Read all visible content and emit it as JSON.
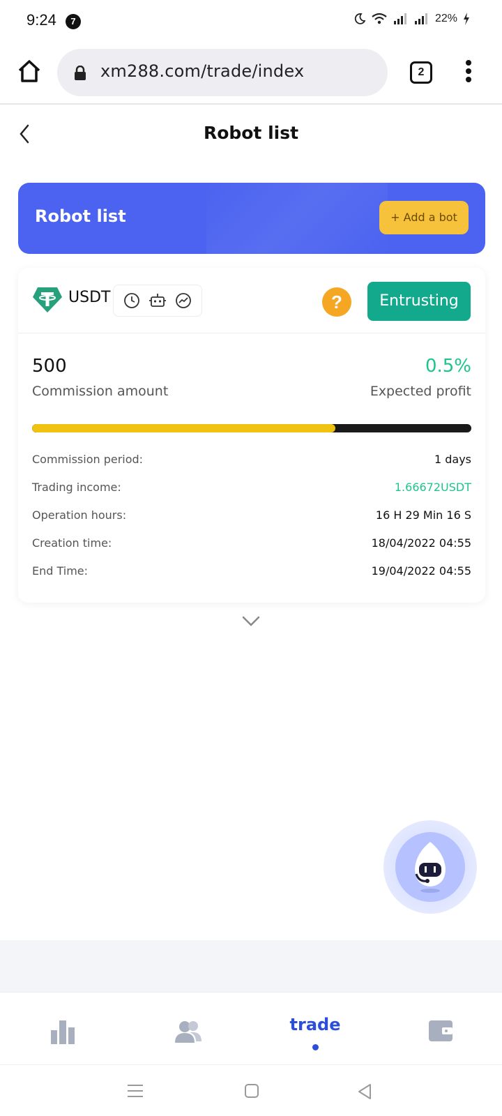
{
  "status_bar": {
    "time": "9:24",
    "notification_count": "7",
    "battery": "22%"
  },
  "browser": {
    "url": "xm288.com/trade/index",
    "tab_count": "2"
  },
  "header": {
    "title": "Robot list"
  },
  "banner": {
    "title": "Robot list",
    "add_button": "+ Add a bot"
  },
  "bot": {
    "coin": "USDT",
    "status_button": "Entrusting",
    "help_symbol": "?",
    "commission_amount": "500",
    "commission_amount_label": "Commission amount",
    "expected_profit": "0.5%",
    "expected_profit_label": "Expected profit",
    "progress_fraction": 0.69,
    "details": [
      {
        "label": "Commission period:",
        "value": "1 days"
      },
      {
        "label": "Trading income:",
        "value": "1.66672USDT"
      },
      {
        "label": "Operation hours:",
        "value": "16 H 29 Min 16 S"
      },
      {
        "label": "Creation time:",
        "value": "18/04/2022 04:55"
      },
      {
        "label": "End Time:",
        "value": "19/04/2022 04:55"
      }
    ]
  },
  "bottom_nav": {
    "active_label": "trade"
  },
  "colors": {
    "accent_blue": "#4b63f0",
    "add_button": "#f7c23b",
    "status_green": "#13a98d",
    "profit_green": "#1ec48d",
    "progress_yellow": "#f0c313",
    "nav_active": "#2b4fd8"
  }
}
